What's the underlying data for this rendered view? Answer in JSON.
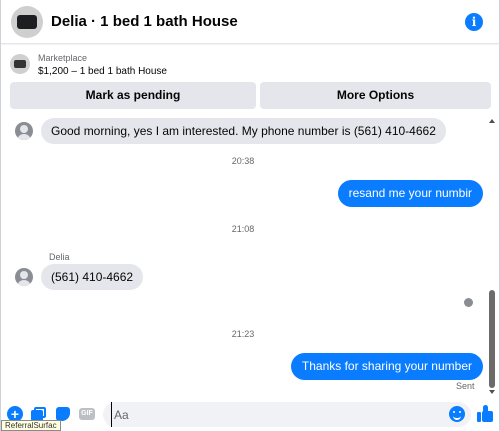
{
  "header": {
    "title": "Delia · 1 bed 1 bath House"
  },
  "marketplace": {
    "label": "Marketplace",
    "listing": "$1,200 – 1 bed 1 bath House",
    "mark_pending_label": "Mark as pending",
    "more_options_label": "More Options"
  },
  "thread": {
    "msg1": "Good morning, yes I am interested. My phone number is (561) 410-4662",
    "time1": "20:38",
    "msg2": "resand me your numbir",
    "time2": "21:08",
    "sender_name": "Delia",
    "msg3": "(561) 410-4662",
    "time3": "21:23",
    "msg4": "Thanks for sharing your number",
    "status": "Sent"
  },
  "composer": {
    "placeholder": "Aa",
    "gif_label": "GIF"
  },
  "tooltip": {
    "text": "ReferralSurfac"
  },
  "colors": {
    "accent": "#0a7cff",
    "bubble_in": "#e4e6eb",
    "button_bg": "#e4e6eb"
  }
}
